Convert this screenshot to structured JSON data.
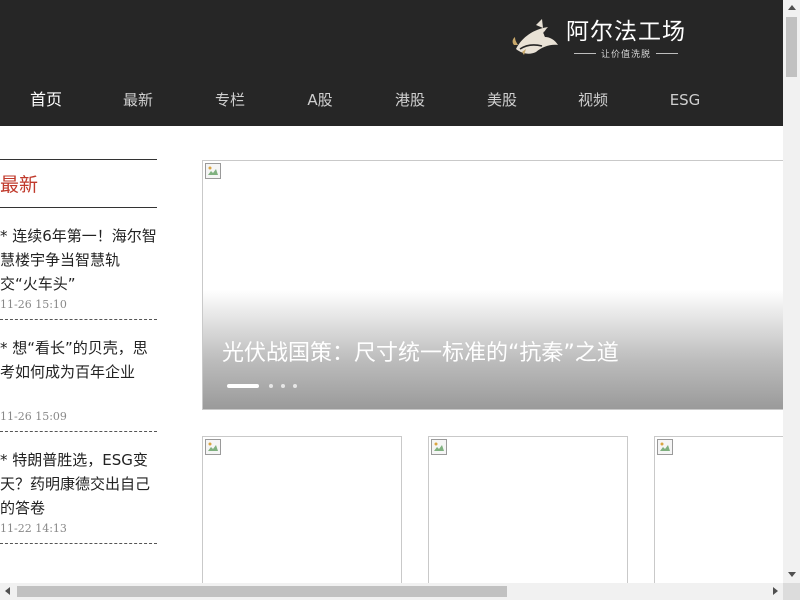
{
  "header": {
    "logo_title": "阿尔法工场",
    "logo_slogan": "让价值洗脱",
    "background": "#262626"
  },
  "nav": {
    "items": [
      {
        "label": "首页",
        "active": true
      },
      {
        "label": "最新",
        "active": false
      },
      {
        "label": "专栏",
        "active": false
      },
      {
        "label": "A股",
        "active": false
      },
      {
        "label": "港股",
        "active": false
      },
      {
        "label": "美股",
        "active": false
      },
      {
        "label": "视频",
        "active": false
      },
      {
        "label": "ESG",
        "active": false
      }
    ]
  },
  "sidebar": {
    "title": "最新",
    "title_color": "#c0392b",
    "items": [
      {
        "title": "* 连续6年第一！海尔智慧楼宇争当智慧轨交“火车头”",
        "time": "11-26 15:10"
      },
      {
        "title": "* 想“看长”的贝壳，思考如何成为百年企业",
        "time": "11-26 15:09"
      },
      {
        "title": "* 特朗普胜选，ESG变天？药明康德交出自己的答卷",
        "time": "11-22 14:13"
      }
    ]
  },
  "slider": {
    "caption": "光伏战国策：尺寸统一标准的“抗秦”之道",
    "slide_count": 4,
    "active_slide": 1
  },
  "cards": {
    "count": 3
  }
}
